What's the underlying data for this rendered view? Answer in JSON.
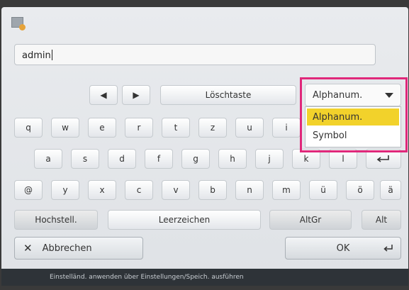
{
  "input": {
    "value": "admin"
  },
  "toolbar": {
    "left_arrow": "◀",
    "right_arrow": "▶",
    "delete_label": "Löschtaste",
    "mode_selected": "Alphanum."
  },
  "mode_menu": {
    "items": [
      "Alphanum.",
      "Symbol"
    ]
  },
  "keys": {
    "row1": [
      "q",
      "w",
      "e",
      "r",
      "t",
      "z",
      "u",
      "i"
    ],
    "row2": [
      "a",
      "s",
      "d",
      "f",
      "g",
      "h",
      "j",
      "k",
      "l"
    ],
    "row3": [
      "@",
      "y",
      "x",
      "c",
      "v",
      "b",
      "n",
      "m",
      "ü",
      "ö",
      "ä"
    ],
    "row4": {
      "shift": "Hochstell.",
      "space": "Leerzeichen",
      "altgr": "AltGr",
      "alt": "Alt"
    }
  },
  "actions": {
    "cancel_label": "Abbrechen",
    "ok_label": "OK"
  },
  "status": {
    "text": "Einstelländ. anwenden über Einstellungen/Speich. ausführen"
  }
}
